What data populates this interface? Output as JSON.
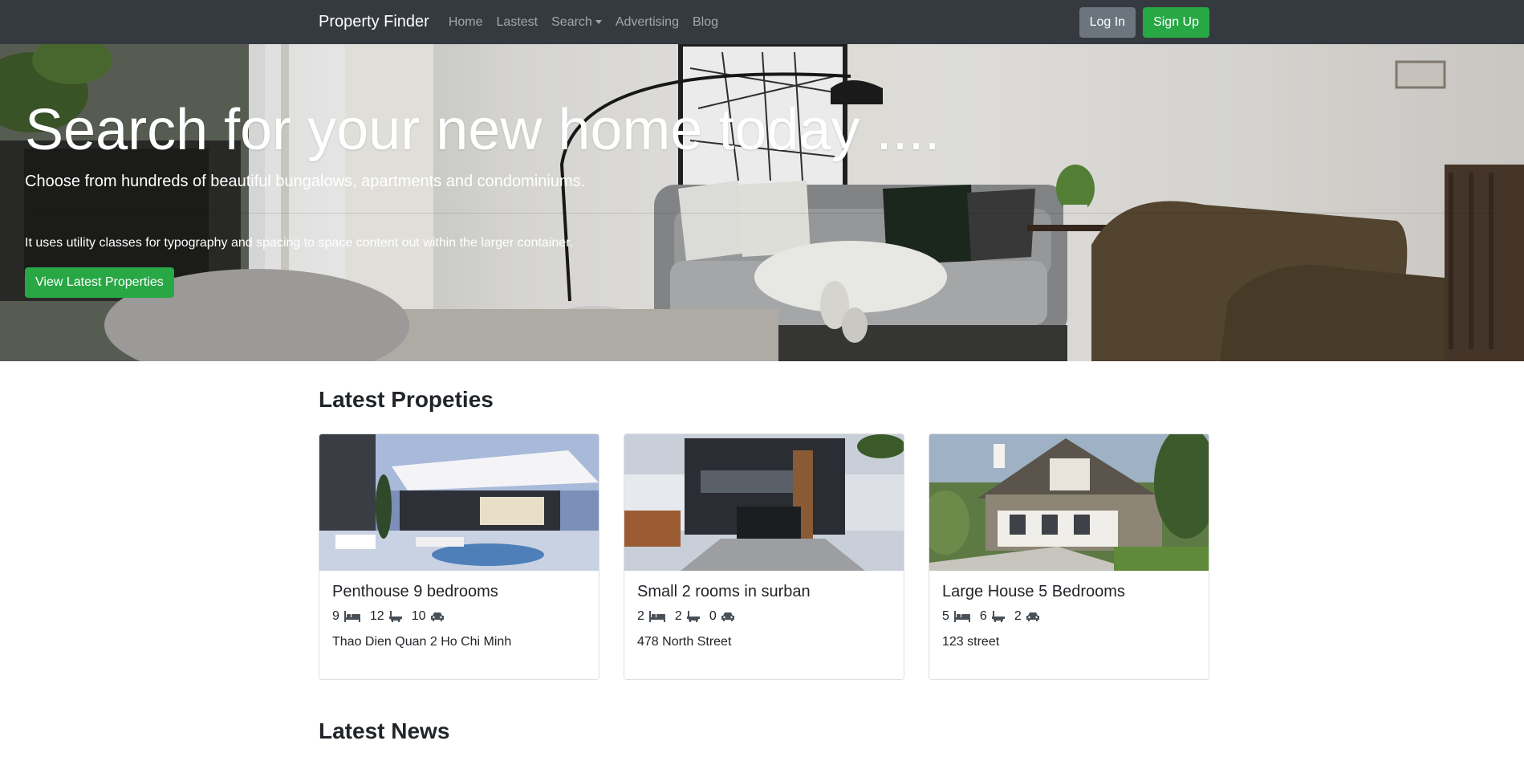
{
  "nav": {
    "brand": "Property Finder",
    "links": [
      "Home",
      "Lastest",
      "Search",
      "Advertising",
      "Blog"
    ],
    "login": "Log In",
    "signup": "Sign Up"
  },
  "hero": {
    "title": "Search for your new home today ....",
    "subtitle": "Choose from hundreds of beautiful bungalows, apartments and condominiums.",
    "text": "It uses utility classes for typography and spacing to space content out within the larger container.",
    "button": "View Latest Properties"
  },
  "latest": {
    "heading": "Latest Propeties",
    "cards": [
      {
        "title": "Penthouse 9 bedrooms",
        "beds": "9",
        "baths": "12",
        "garages": "10",
        "address": "Thao Dien Quan 2 Ho Chi Minh"
      },
      {
        "title": "Small 2 rooms in surban",
        "beds": "2",
        "baths": "2",
        "garages": "0",
        "address": "478 North Street"
      },
      {
        "title": "Large House 5 Bedrooms",
        "beds": "5",
        "baths": "6",
        "garages": "2",
        "address": "123 street"
      }
    ]
  },
  "news": {
    "heading": "Latest News"
  },
  "icons": {
    "bed": "bed-icon",
    "bath": "bath-icon",
    "car": "car-icon",
    "caret": "caret-down-icon"
  },
  "colors": {
    "navbar": "#343a40",
    "success": "#28a745",
    "secondary": "#6c757d"
  }
}
